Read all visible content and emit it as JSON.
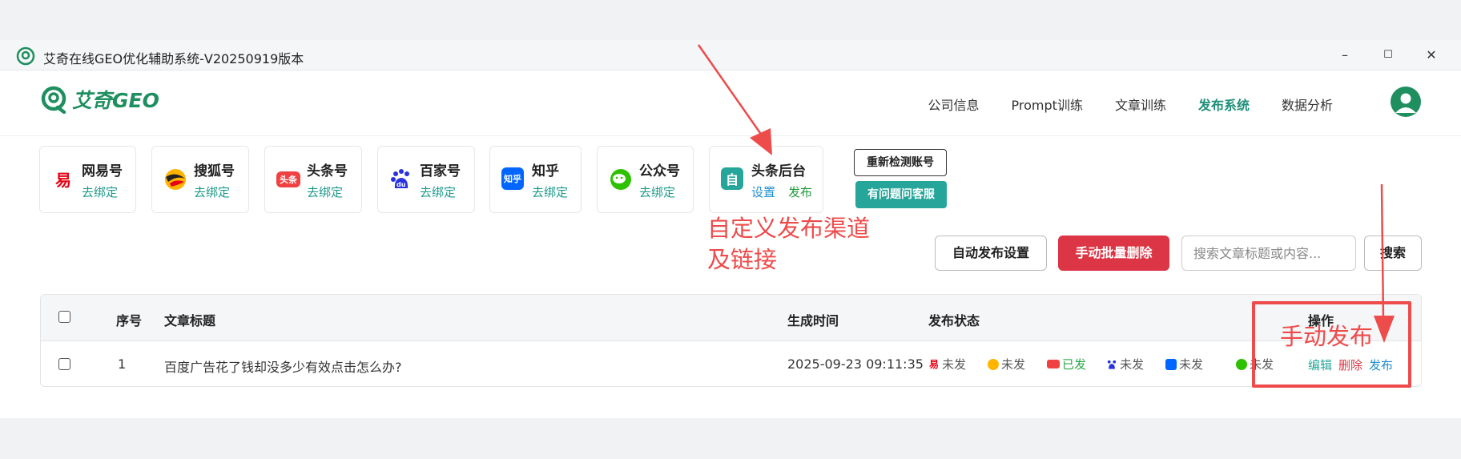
{
  "window": {
    "title": "艾奇在线GEO优化辅助系统-V20250919版本",
    "minimize": "–",
    "maximize": "☐",
    "close": "✕"
  },
  "header": {
    "logo_text": "艾奇GEO",
    "nav": [
      "公司信息",
      "Prompt训练",
      "文章训练",
      "发布系统",
      "数据分析"
    ],
    "active_nav": "发布系统"
  },
  "channels": [
    {
      "name": "网易号",
      "link": "去绑定",
      "icon": "netease-icon",
      "color": "#e60012"
    },
    {
      "name": "搜狐号",
      "link": "去绑定",
      "icon": "sohu-icon",
      "color": "#ffb400"
    },
    {
      "name": "头条号",
      "link": "去绑定",
      "icon": "toutiao-icon",
      "color": "#f04142",
      "badge": "头条"
    },
    {
      "name": "百家号",
      "link": "去绑定",
      "icon": "baijia-icon",
      "color": "#2932e1",
      "badge": "du"
    },
    {
      "name": "知乎",
      "link": "去绑定",
      "icon": "zhihu-icon",
      "color": "#0066ff",
      "badge": "知乎"
    },
    {
      "name": "公众号",
      "link": "去绑定",
      "icon": "wechat-icon",
      "color": "#2ec100"
    },
    {
      "name": "头条后台",
      "link": "设置",
      "link2": "发布",
      "icon": "toutiao-backend-icon",
      "color": "#26a69a",
      "badge": "自"
    }
  ],
  "buttons": {
    "recheck": "重新检测账号",
    "support": "有问题问客服",
    "auto_publish": "自动发布设置",
    "batch_delete": "手动批量删除",
    "search": "搜索"
  },
  "search": {
    "placeholder": "搜索文章标题或内容..."
  },
  "table": {
    "headers": {
      "index": "序号",
      "title": "文章标题",
      "time": "生成时间",
      "status": "发布状态",
      "ops": "操作"
    },
    "rows": [
      {
        "index": "1",
        "title": "百度广告花了钱却没多少有效点击怎么办?",
        "time": "2025-09-23 09:11:35",
        "statuses": [
          {
            "channel": "网易号",
            "text": "未发",
            "done": false
          },
          {
            "channel": "搜狐号",
            "text": "未发",
            "done": false
          },
          {
            "channel": "头条号",
            "text": "已发",
            "done": true
          },
          {
            "channel": "百家号",
            "text": "未发",
            "done": false
          },
          {
            "channel": "知乎",
            "text": "未发",
            "done": false
          },
          {
            "channel": "公众号",
            "text": "未发",
            "done": false
          }
        ],
        "ops": {
          "edit": "编辑",
          "delete": "删除",
          "publish": "发布"
        }
      }
    ]
  },
  "annotations": {
    "custom_channel_line1": "自定义发布渠道",
    "custom_channel_line2": "及链接",
    "manual_publish": "手动发布",
    "color": "#ee4b4b"
  }
}
